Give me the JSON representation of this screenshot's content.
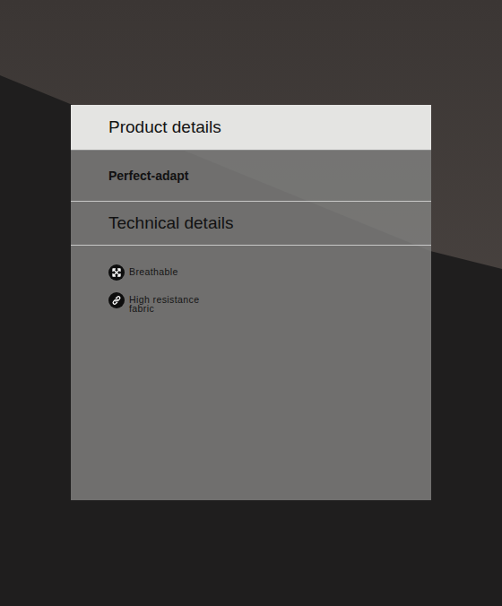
{
  "panel": {
    "sections": [
      {
        "label": "Product details",
        "kind": "heading",
        "selected": true
      },
      {
        "label": "Perfect-adapt",
        "kind": "sub",
        "selected": false
      },
      {
        "label": "Technical details",
        "kind": "heading",
        "selected": false
      }
    ],
    "features": [
      {
        "label": "Breathable",
        "kind": "breathable"
      },
      {
        "label": "High resistance fabric",
        "kind": "link"
      }
    ]
  }
}
